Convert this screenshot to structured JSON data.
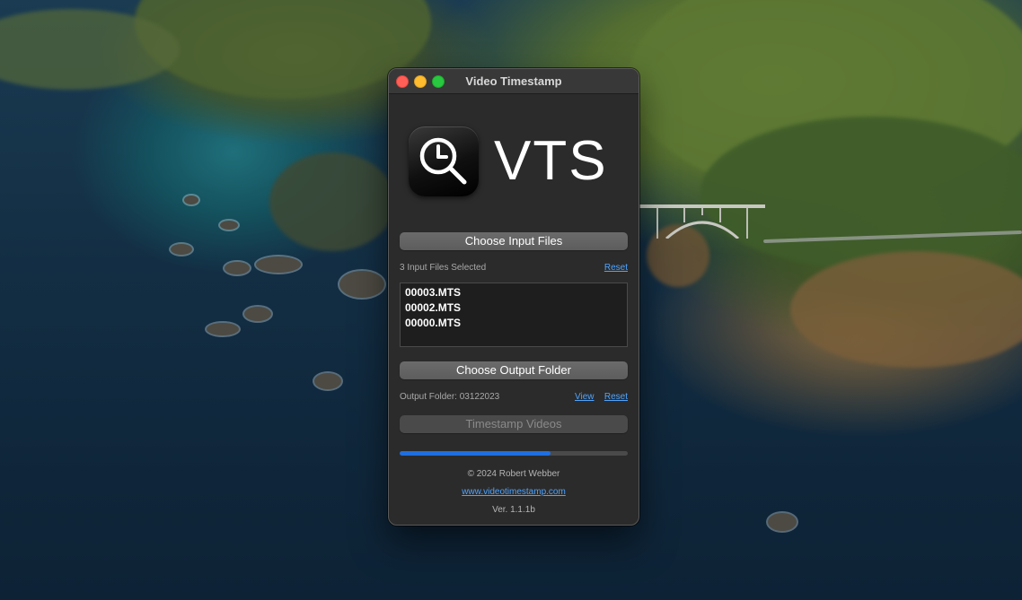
{
  "window": {
    "title": "Video Timestamp"
  },
  "logo": {
    "text": "VTS",
    "icon": "clock-magnifier-icon"
  },
  "input": {
    "button_label": "Choose Input Files",
    "status": "3 Input Files Selected",
    "reset_label": "Reset",
    "files": [
      "00003.MTS",
      "00002.MTS",
      "00000.MTS"
    ]
  },
  "output": {
    "button_label": "Choose Output Folder",
    "status": "Output Folder: 03122023",
    "view_label": "View",
    "reset_label": "Reset"
  },
  "action": {
    "timestamp_label": "Timestamp Videos",
    "progress": 0.66
  },
  "footer": {
    "copyright": "© 2024 Robert Webber",
    "website": "www.videotimestamp.com",
    "version": "Ver. 1.1.1b"
  },
  "colors": {
    "accent": "#1f6fe0",
    "link": "#4ea3ff",
    "window_bg": "#2b2b2b"
  }
}
